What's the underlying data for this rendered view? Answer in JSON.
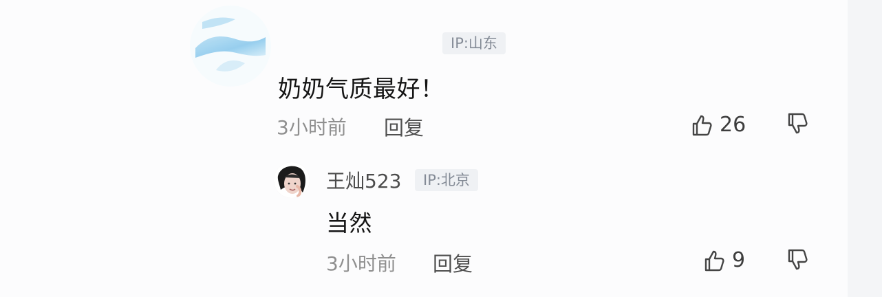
{
  "comments": [
    {
      "username": "",
      "ip": "IP:山东",
      "text": "奶奶气质最好！",
      "time": "3小时前",
      "reply_label": "回复",
      "likes": "26"
    },
    {
      "username": "王灿523",
      "ip": "IP:北京",
      "text": "当然",
      "time": "3小时前",
      "reply_label": "回复",
      "likes": "9"
    }
  ],
  "icons": {
    "like": "thumbs-up-icon",
    "dislike": "thumbs-down-icon"
  },
  "colors": {
    "background": "#fcfcfd",
    "ip_badge_bg": "#eff1f4",
    "ip_badge_text": "#848b96",
    "text": "#151515",
    "meta": "#8f8f8f"
  }
}
